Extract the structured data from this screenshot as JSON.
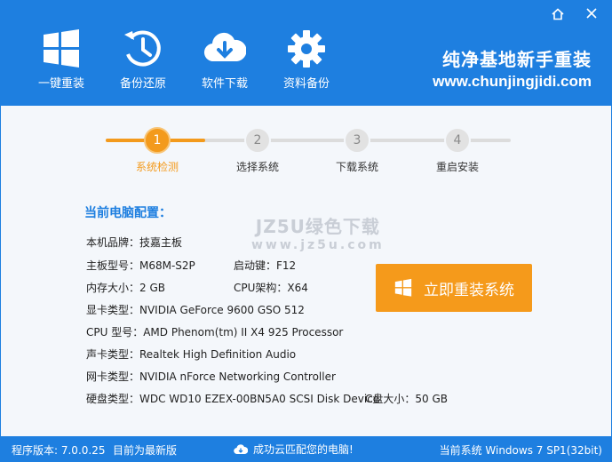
{
  "toolbar": {
    "items": [
      {
        "label": "一键重装",
        "icon": "windows-icon"
      },
      {
        "label": "备份还原",
        "icon": "history-icon"
      },
      {
        "label": "软件下载",
        "icon": "cloud-download-icon"
      },
      {
        "label": "资料备份",
        "icon": "gear-icon"
      }
    ]
  },
  "brand": {
    "name": "纯净基地新手重装",
    "url": "www.chunjingjidi.com"
  },
  "steps": [
    {
      "number": "1",
      "label": "系统检测"
    },
    {
      "number": "2",
      "label": "选择系统"
    },
    {
      "number": "3",
      "label": "下载系统"
    },
    {
      "number": "4",
      "label": "重启安装"
    }
  ],
  "config": {
    "title": "当前电脑配置：",
    "brand": "本机品牌：技嘉主板",
    "board": "主板型号：M68M-S2P",
    "boot_key": "启动键：F12",
    "memory": "内存大小：2 GB",
    "cpu_arch": "CPU架构：X64",
    "gpu": "显卡类型：NVIDIA GeForce 9600 GSO 512",
    "cpu": "CPU 型号：AMD Phenom(tm) II X4 925 Processor",
    "audio": "声卡类型：Realtek High Definition Audio",
    "network": "网卡类型：NVIDIA nForce Networking Controller",
    "disk": "硬盘类型：WDC WD10 EZEX-00BN5A0 SCSI Disk Device",
    "c_drive": "C盘大小：50 GB"
  },
  "watermark": {
    "line1": "JZ5U绿色下载",
    "line2": "www.jz5u.com"
  },
  "install_button": {
    "label": "立即重装系统"
  },
  "statusbar": {
    "version": "程序版本: 7.0.0.25",
    "update": "目前为最新版",
    "cloud": "成功云匹配您的电脑!",
    "current_system": "当前系统 Windows 7 SP1(32bit)"
  },
  "colors": {
    "primary": "#1e7fe0",
    "accent": "#f39a1c"
  }
}
